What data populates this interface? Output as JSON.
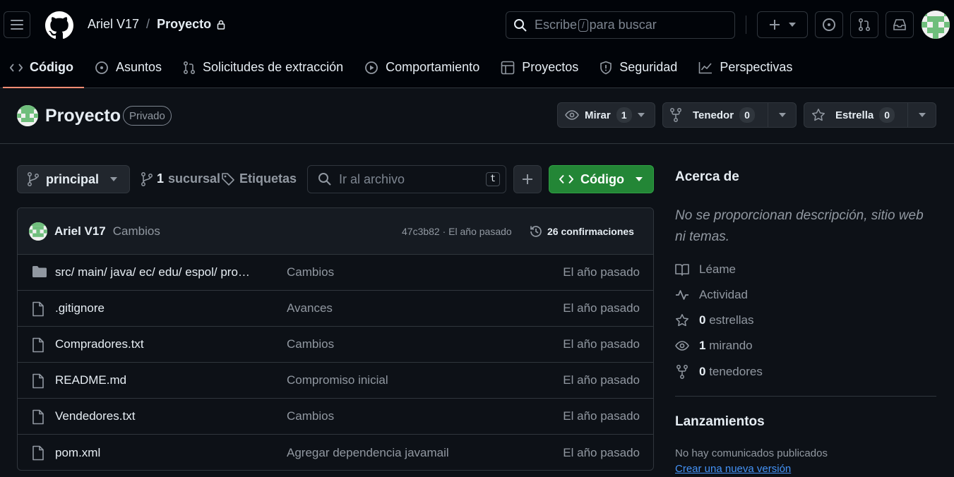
{
  "header": {
    "owner": "Ariel V17",
    "separator": "/",
    "repo": "Proyecto",
    "search_prefix": "Escribe",
    "search_key": "/",
    "search_suffix": "para buscar"
  },
  "nav": {
    "tabs": [
      {
        "label": "Código",
        "icon": "code-icon"
      },
      {
        "label": "Asuntos",
        "icon": "issue-icon"
      },
      {
        "label": "Solicitudes de extracción",
        "icon": "pull-request-icon"
      },
      {
        "label": "Comportamiento",
        "icon": "play-icon"
      },
      {
        "label": "Proyectos",
        "icon": "table-icon"
      },
      {
        "label": "Seguridad",
        "icon": "shield-icon"
      },
      {
        "label": "Perspectivas",
        "icon": "graph-icon"
      }
    ]
  },
  "repo": {
    "title": "Proyecto",
    "visibility": "Privado",
    "watch_label": "Mirar",
    "watch_count": "1",
    "fork_label": "Tenedor",
    "fork_count": "0",
    "star_label": "Estrella",
    "star_count": "0"
  },
  "toolbar": {
    "branch": "principal",
    "branch_count": "1",
    "branch_word": "sucursal",
    "tags_label": "Etiquetas",
    "file_search_placeholder": "Ir al archivo",
    "file_search_key": "t",
    "code_label": "Código"
  },
  "commit": {
    "author": "Ariel V17",
    "message": "Cambios",
    "hash_time": "47c3b82 · El año pasado",
    "count_label": "26 confirmaciones"
  },
  "files": [
    {
      "name": "src/ main/ java/ ec/ edu/ espol/ pro…",
      "message": "Cambios",
      "date": "El año pasado",
      "type": "folder"
    },
    {
      "name": ".gitignore",
      "message": "Avances",
      "date": "El año pasado",
      "type": "file"
    },
    {
      "name": "Compradores.txt",
      "message": "Cambios",
      "date": "El año pasado",
      "type": "file"
    },
    {
      "name": "README.md",
      "message": "Compromiso inicial",
      "date": "El año pasado",
      "type": "file"
    },
    {
      "name": "Vendedores.txt",
      "message": "Cambios",
      "date": "El año pasado",
      "type": "file"
    },
    {
      "name": "pom.xml",
      "message": "Agregar dependencia javamail",
      "date": "El año pasado",
      "type": "file"
    }
  ],
  "about": {
    "title": "Acerca de",
    "description": "No se proporcionan descripción, sitio web ni temas.",
    "readme": "Léame",
    "activity": "Actividad",
    "stars_count": "0",
    "stars_word": "estrellas",
    "watching_count": "1",
    "watching_word": "mirando",
    "forks_count": "0",
    "forks_word": "tenedores"
  },
  "releases": {
    "title": "Lanzamientos",
    "none_text": "No hay comunicados publicados",
    "create_link": "Crear una nueva versión"
  },
  "colors": {
    "background": "#0d1117",
    "header_bg": "#010409",
    "accent_tab": "#fd8c73",
    "code_button": "#238636",
    "link": "#4493f8"
  }
}
